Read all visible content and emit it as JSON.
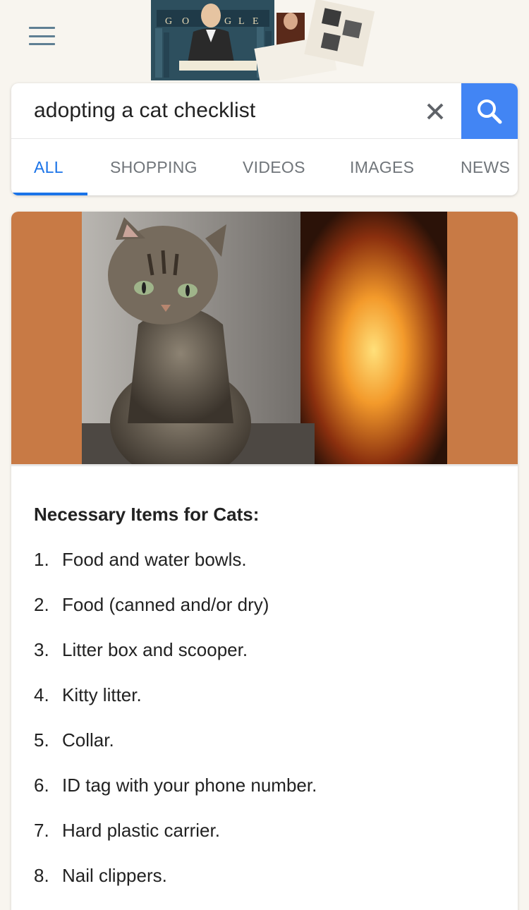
{
  "header": {
    "menu_icon": "hamburger-menu-icon",
    "doodle_letters": [
      "G",
      "O",
      "G",
      "L",
      "E"
    ]
  },
  "search": {
    "query": "adopting a cat checklist",
    "clear_icon": "close-icon",
    "search_icon": "search-icon"
  },
  "tabs": [
    {
      "label": "ALL",
      "active": true
    },
    {
      "label": "SHOPPING",
      "active": false
    },
    {
      "label": "VIDEOS",
      "active": false
    },
    {
      "label": "IMAGES",
      "active": false
    },
    {
      "label": "NEWS",
      "active": false
    }
  ],
  "result": {
    "heading": "Necessary Items for Cats:",
    "items": [
      {
        "num": "1.",
        "text": "Food and water bowls."
      },
      {
        "num": "2.",
        "text": "Food (canned and/or dry)"
      },
      {
        "num": "3.",
        "text": "Litter box and scooper."
      },
      {
        "num": "4.",
        "text": "Kitty litter."
      },
      {
        "num": "5.",
        "text": "Collar."
      },
      {
        "num": "6.",
        "text": "ID tag with your phone number."
      },
      {
        "num": "7.",
        "text": "Hard plastic carrier."
      },
      {
        "num": "8.",
        "text": "Nail clippers."
      }
    ]
  },
  "colors": {
    "accent": "#1a73e8",
    "search_button": "#4285f4",
    "hero_background": "#c87a45"
  }
}
